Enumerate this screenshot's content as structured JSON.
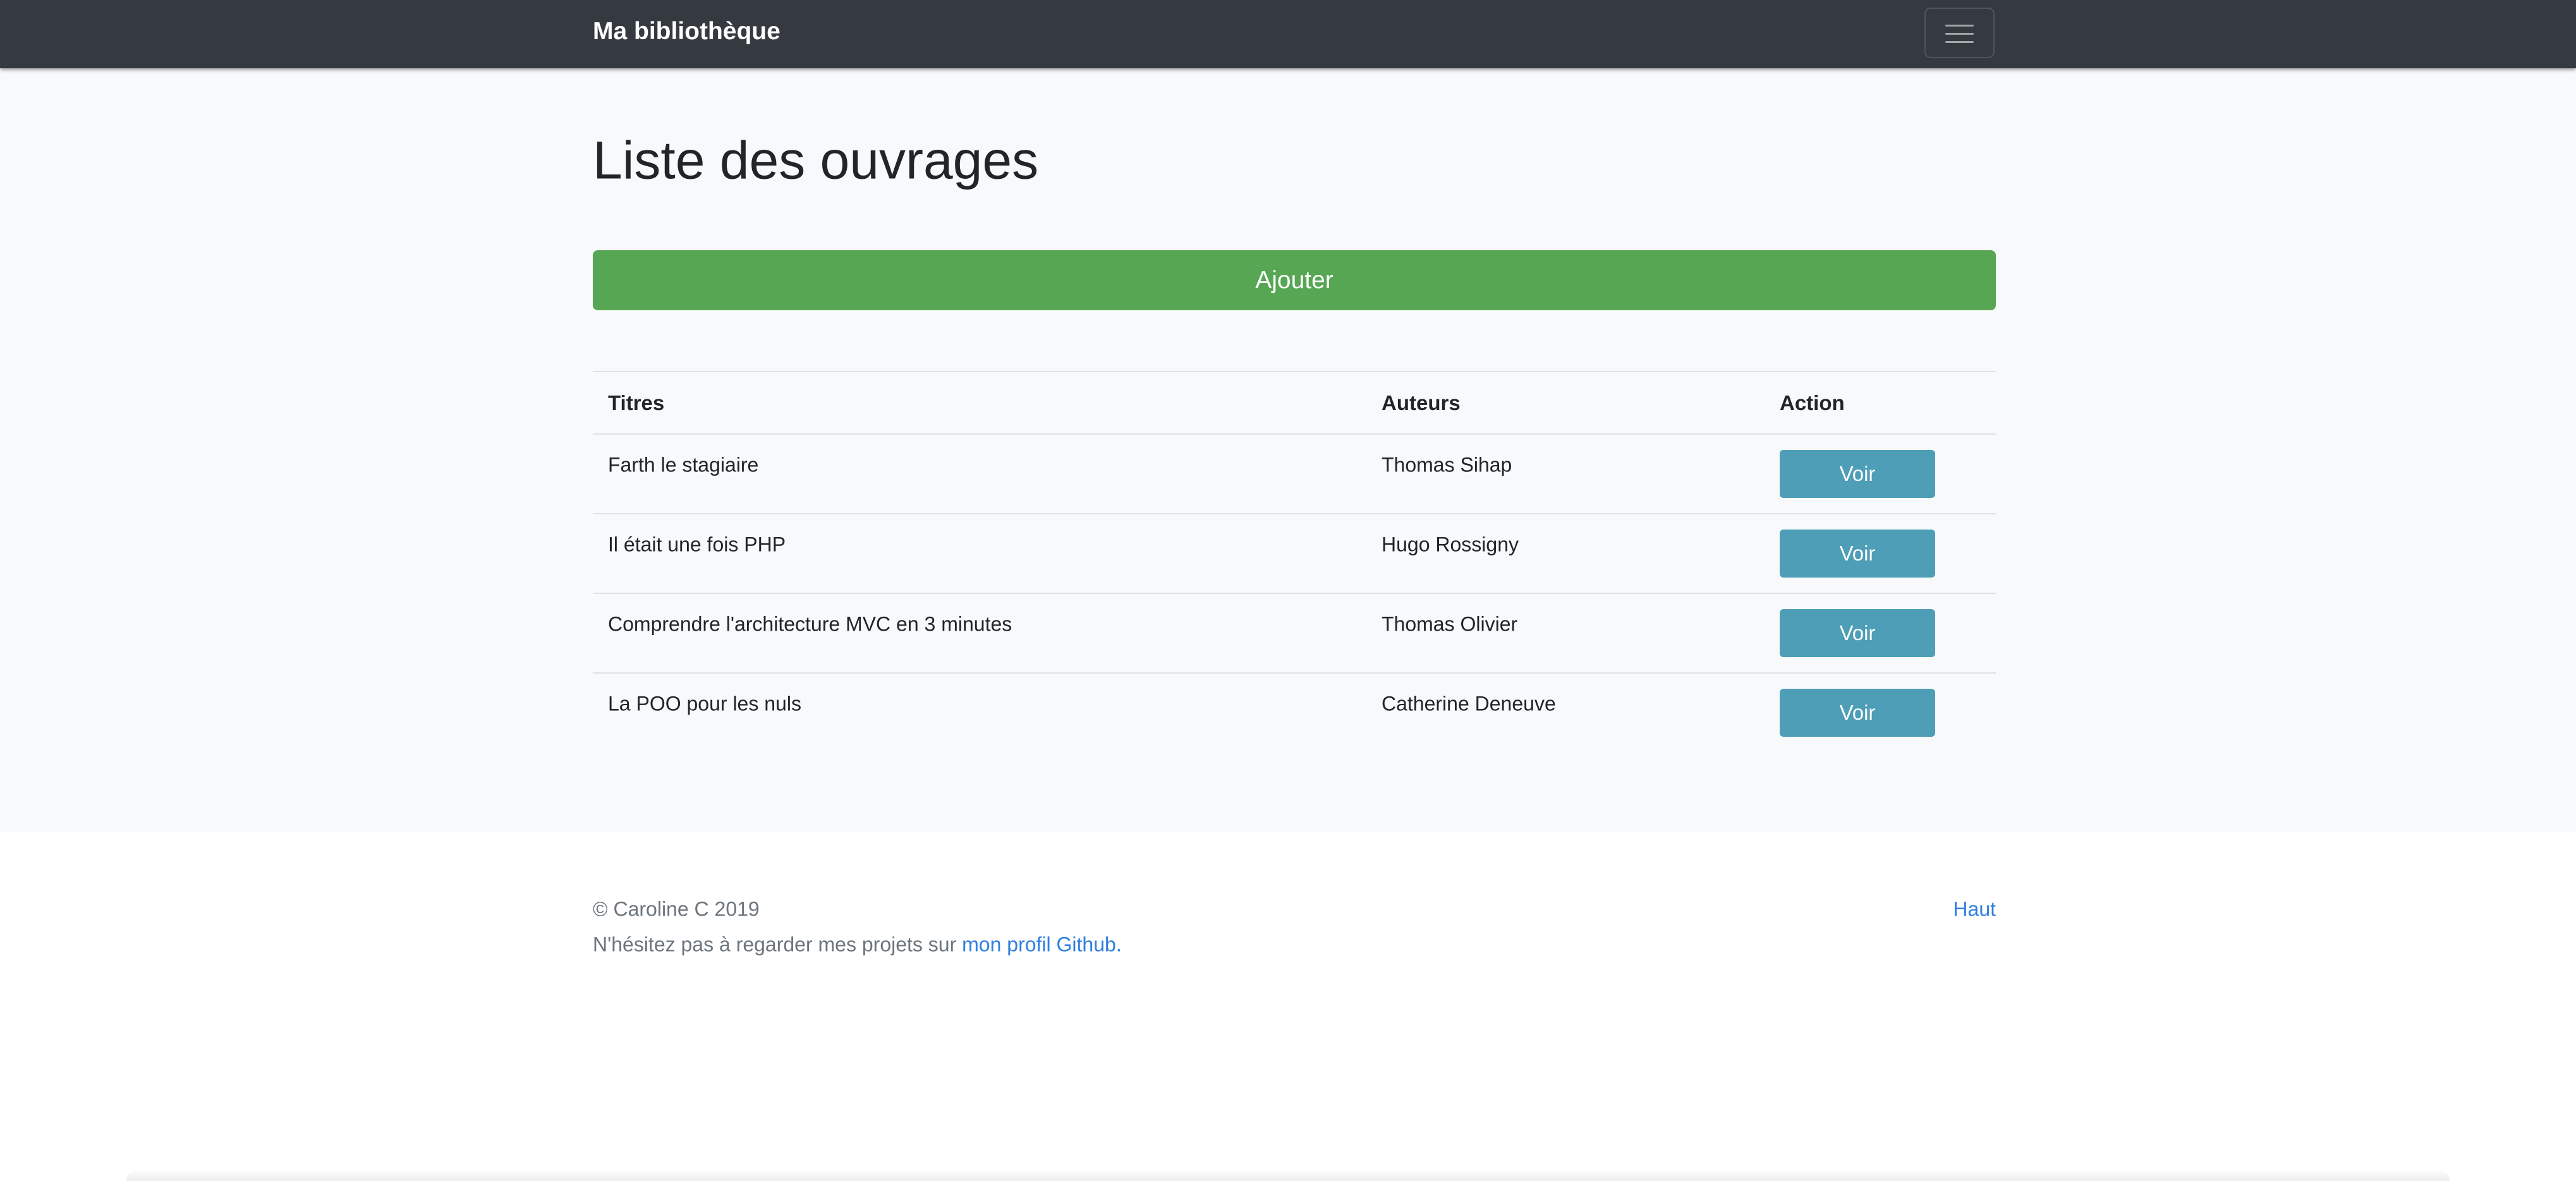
{
  "navbar": {
    "brand": "Ma bibliothèque",
    "menu_icon": "hamburger-menu-icon"
  },
  "main": {
    "title": "Liste des ouvrages",
    "add_label": "Ajouter",
    "table": {
      "headers": [
        "Titres",
        "Auteurs",
        "Action"
      ],
      "rows": [
        {
          "title": "Farth le stagiaire",
          "author": "Thomas Sihap",
          "action": "Voir"
        },
        {
          "title": "Il était une fois PHP",
          "author": "Hugo Rossigny",
          "action": "Voir"
        },
        {
          "title": "Comprendre l'architecture MVC en 3 minutes",
          "author": "Thomas Olivier",
          "action": "Voir"
        },
        {
          "title": "La POO pour les nuls",
          "author": "Catherine Deneuve",
          "action": "Voir"
        }
      ]
    }
  },
  "footer": {
    "copyright": "© Caroline C 2019",
    "message_prefix": "N'hésitez pas à regarder mes projets sur ",
    "github_link": "mon profil Github.",
    "top_link": "Haut"
  },
  "colors": {
    "navbar": "#343a40",
    "success": "#56a653",
    "info": "#4d9eb6",
    "link": "#2f7fe0",
    "page_background": "#f8f9fa"
  }
}
